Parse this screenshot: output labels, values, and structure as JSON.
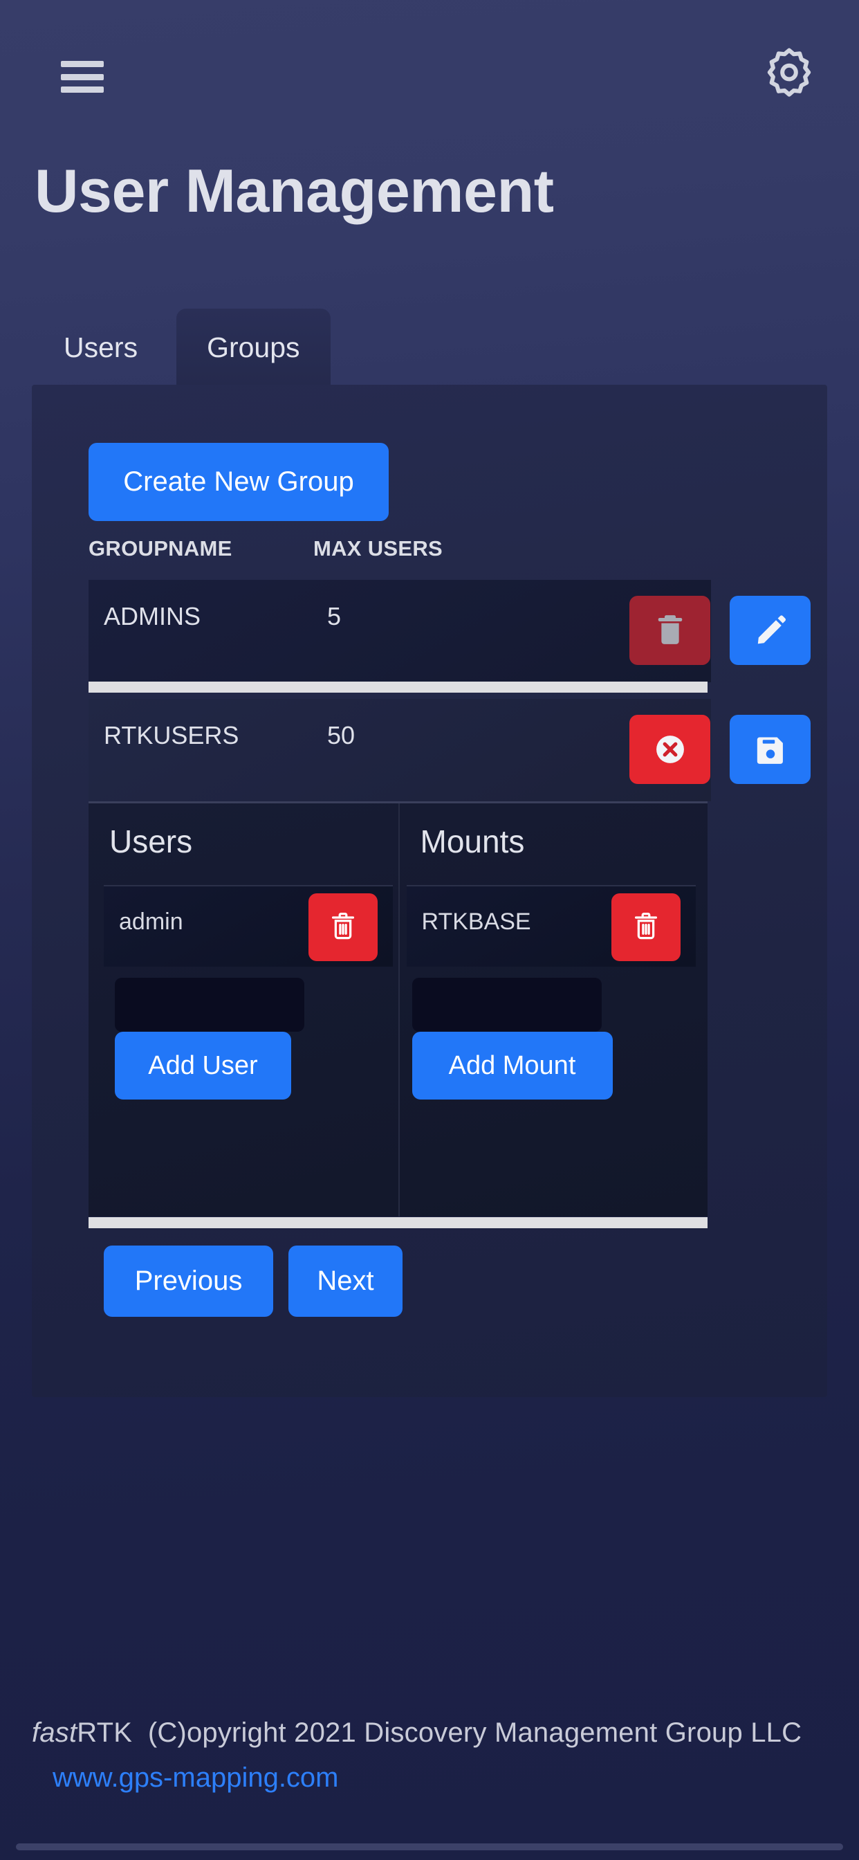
{
  "header": {
    "menu_icon": "hamburger-icon",
    "settings_icon": "gear-icon",
    "title": "User Management"
  },
  "tabs": [
    {
      "label": "Users",
      "active": false
    },
    {
      "label": "Groups",
      "active": true
    }
  ],
  "toolbar": {
    "create_group_label": "Create New Group"
  },
  "table": {
    "columns": [
      "GROUPNAME",
      "MAX USERS"
    ],
    "rows": [
      {
        "groupname": "ADMINS",
        "max_users": "5",
        "actions": [
          {
            "name": "delete-button",
            "icon": "trash-icon",
            "color": "#9e2331"
          },
          {
            "name": "edit-button",
            "icon": "pencil-icon",
            "color": "#2277f8"
          }
        ]
      },
      {
        "groupname": "RTKUSERS",
        "max_users": "50",
        "actions": [
          {
            "name": "cancel-button",
            "icon": "x-circle-icon",
            "color": "#e5262f"
          },
          {
            "name": "save-button",
            "icon": "floppy-icon",
            "color": "#2277f8"
          }
        ]
      }
    ]
  },
  "detail": {
    "users": {
      "title": "Users",
      "items": [
        {
          "label": "admin",
          "delete_icon": "trash-icon"
        }
      ],
      "input_value": "",
      "input_placeholder": "",
      "add_label": "Add User"
    },
    "mounts": {
      "title": "Mounts",
      "items": [
        {
          "label": "RTKBASE",
          "delete_icon": "trash-icon"
        }
      ],
      "input_value": "",
      "input_placeholder": "",
      "add_label": "Add Mount"
    }
  },
  "pager": {
    "previous_label": "Previous",
    "next_label": "Next"
  },
  "footer": {
    "brand_italic": "fast",
    "brand_rest": "RTK",
    "copyright": "(C)opyright 2021 Discovery Management Group LLC",
    "link": "www.gps-mapping.com"
  },
  "colors": {
    "accent_blue": "#2277f8",
    "danger_red": "#e5262f",
    "danger_muted": "#9e2331",
    "divider": "#dfdfe2",
    "page_bg": "#1b2045",
    "link": "#2d7ff9"
  }
}
